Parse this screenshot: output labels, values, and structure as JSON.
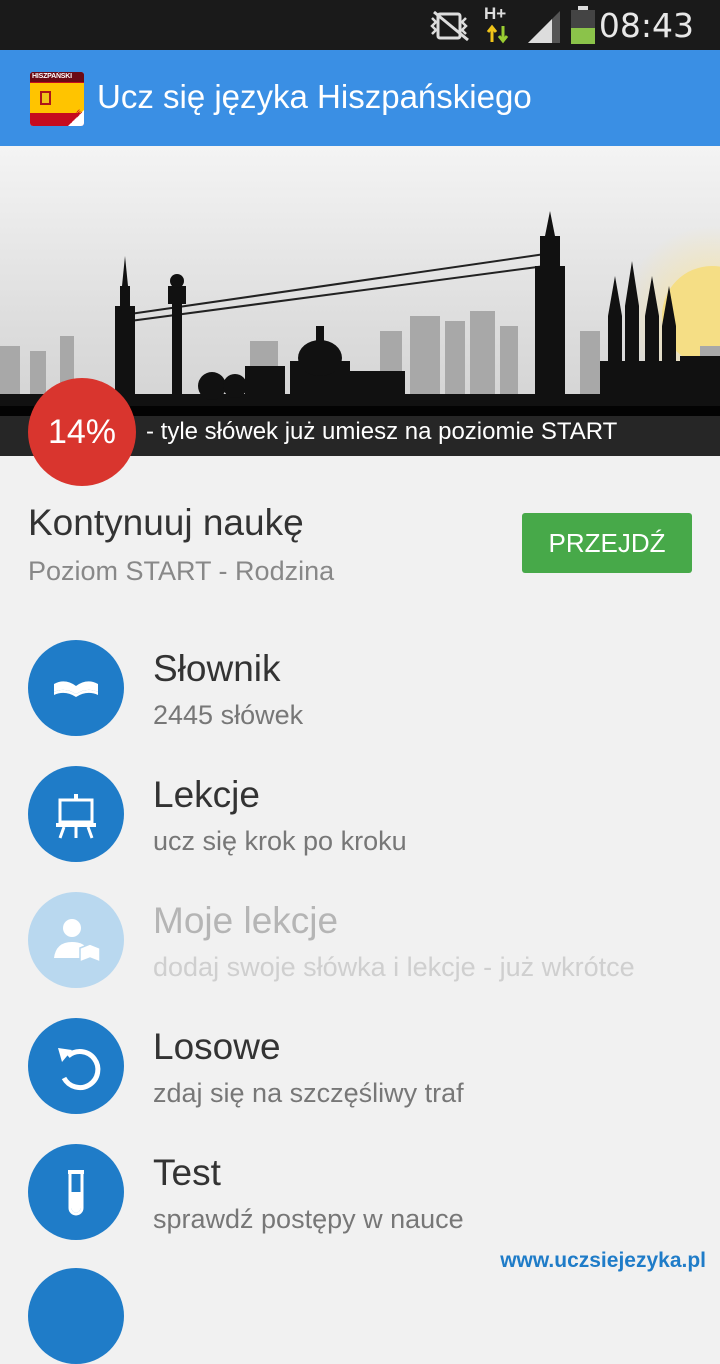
{
  "status_bar": {
    "time": "08:43",
    "network": "H+",
    "icons": [
      "mute-vibrate-icon",
      "data-arrows-icon",
      "signal-icon",
      "battery-icon"
    ]
  },
  "app_bar": {
    "title": "Ucz się języka Hiszpańskiego",
    "icon_name": "spain-flag-icon",
    "icon_top_text": "HISZPAŃSKI",
    "icon_corner_text": "FREE",
    "color": "#3a8fe4"
  },
  "banner": {
    "progress_percent": "14%",
    "caption": "- tyle słówek już umiesz na poziomie START",
    "badge_color": "#d9352e"
  },
  "continue": {
    "title": "Kontynuuj naukę",
    "subtitle": "Poziom START - Rodzina",
    "button_label": "PRZEJDŹ",
    "button_color": "#47a949"
  },
  "menu": {
    "items": [
      {
        "label": "Słownik",
        "desc": "2445 słówek",
        "icon": "book-icon"
      },
      {
        "label": "Lekcje",
        "desc": "ucz się krok po kroku",
        "icon": "easel-icon"
      },
      {
        "label": "Moje lekcje",
        "desc": "dodaj swoje słówka i lekcje - już wkrótce",
        "icon": "user-book-icon",
        "disabled": true
      },
      {
        "label": "Losowe",
        "desc": "zdaj się na szczęśliwy traf",
        "icon": "undo-arrow-icon"
      },
      {
        "label": "Test",
        "desc": "sprawdź postępy w nauce",
        "icon": "test-tube-icon"
      }
    ],
    "accent": "#1f7cc8"
  },
  "footer": {
    "link": "www.uczsiejezyka.pl"
  }
}
